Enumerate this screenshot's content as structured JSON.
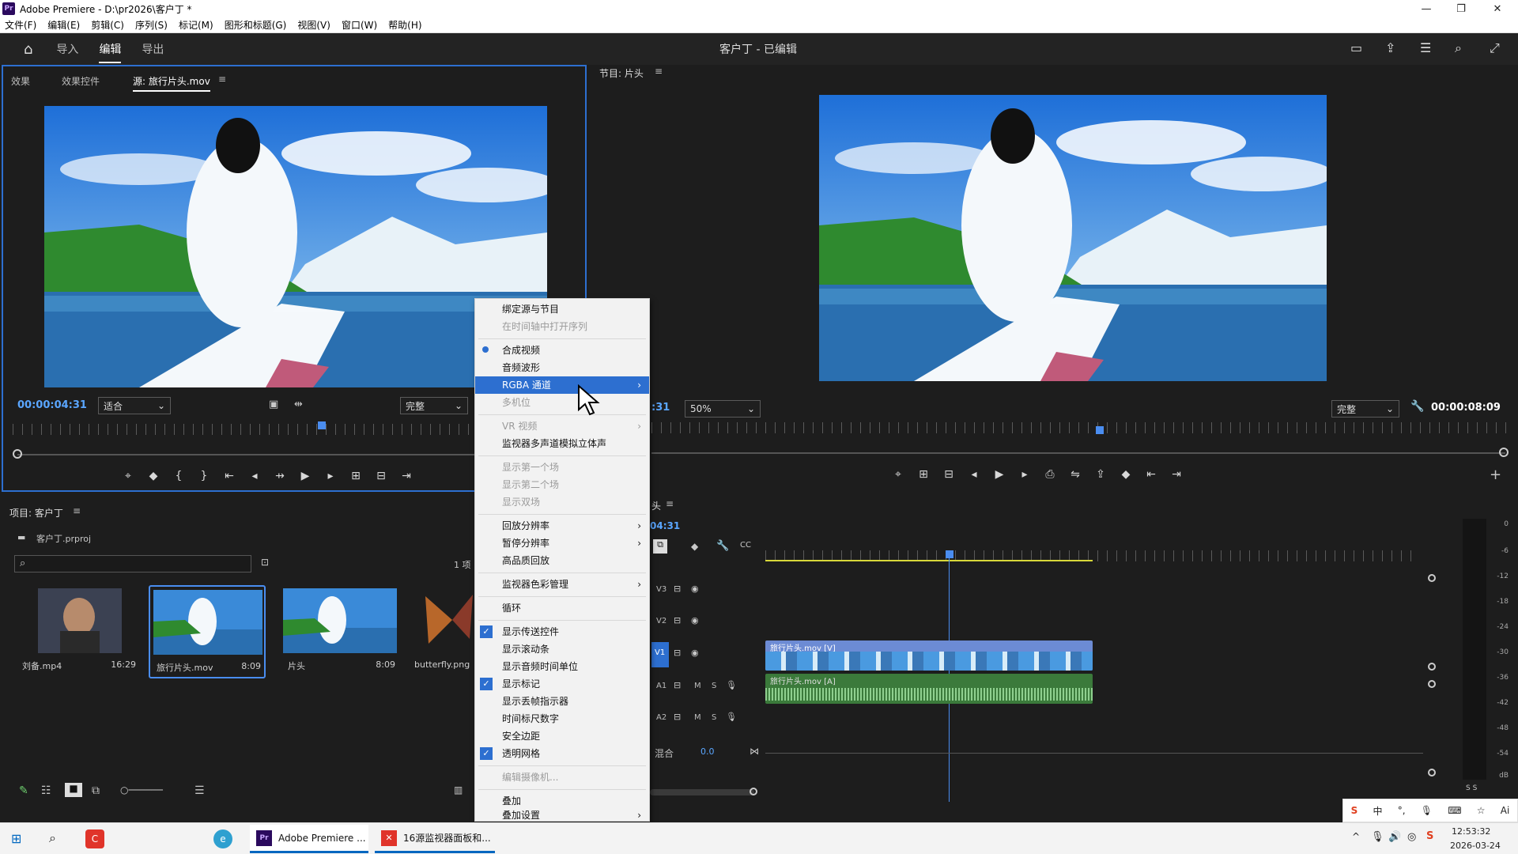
{
  "window": {
    "title": "Adobe Premiere - D:\\pr2026\\客户丁 *",
    "logo": "Pr",
    "controls": {
      "minimize": "—",
      "maximize": "❐",
      "close": "✕"
    }
  },
  "menu": [
    "文件(F)",
    "编辑(E)",
    "剪辑(C)",
    "序列(S)",
    "标记(M)",
    "图形和标题(G)",
    "视图(V)",
    "窗口(W)",
    "帮助(H)"
  ],
  "header": {
    "workspaces": [
      "导入",
      "编辑",
      "导出"
    ],
    "active_workspace": "编辑",
    "project_status": "客户丁 - 已编辑"
  },
  "source": {
    "tabs": [
      "效果",
      "效果控件",
      "源: 旅行片头.mov"
    ],
    "timecode": "00:00:04:31",
    "fit": "适合",
    "quality": "完整"
  },
  "program": {
    "title": "节目: 片头",
    "timecode_left": ":31",
    "zoom": "50%",
    "quality": "完整",
    "timecode_right": "00:00:08:09"
  },
  "context_menu": {
    "items": [
      {
        "label": "绑定源与节目",
        "state": "normal"
      },
      {
        "label": "在时间轴中打开序列",
        "state": "disabled"
      },
      {
        "label": "合成视频",
        "state": "radio"
      },
      {
        "label": "音频波形",
        "state": "normal"
      },
      {
        "label": "RGBA 通道",
        "state": "highlight",
        "submenu": true
      },
      {
        "label": "多机位",
        "state": "disabled"
      },
      {
        "label": "VR 视频",
        "state": "disabled",
        "submenu": true
      },
      {
        "label": "监视器多声道模拟立体声",
        "state": "normal"
      },
      {
        "label": "显示第一个场",
        "state": "disabled"
      },
      {
        "label": "显示第二个场",
        "state": "disabled"
      },
      {
        "label": "显示双场",
        "state": "disabled"
      },
      {
        "label": "回放分辨率",
        "state": "normal",
        "submenu": true
      },
      {
        "label": "暂停分辨率",
        "state": "normal",
        "submenu": true
      },
      {
        "label": "高品质回放",
        "state": "normal"
      },
      {
        "label": "监视器色彩管理",
        "state": "normal",
        "submenu": true
      },
      {
        "label": "循环",
        "state": "normal"
      },
      {
        "label": "显示传送控件",
        "state": "checked"
      },
      {
        "label": "显示滚动条",
        "state": "normal"
      },
      {
        "label": "显示音频时间单位",
        "state": "normal"
      },
      {
        "label": "显示标记",
        "state": "checked"
      },
      {
        "label": "显示丢帧指示器",
        "state": "normal"
      },
      {
        "label": "时间标尺数字",
        "state": "normal"
      },
      {
        "label": "安全边距",
        "state": "normal"
      },
      {
        "label": "透明网格",
        "state": "checked"
      },
      {
        "label": "编辑摄像机...",
        "state": "disabled"
      },
      {
        "label": "叠加",
        "state": "normal"
      },
      {
        "label": "叠加设置",
        "state": "normal",
        "submenu": true
      }
    ]
  },
  "project": {
    "title": "项目: 客户丁",
    "file": "客户丁.prproj",
    "count": "1 项",
    "search_placeholder": "",
    "items": [
      {
        "name": "刘备.mp4",
        "duration": "16:29"
      },
      {
        "name": "旅行片头.mov",
        "duration": "8:09"
      },
      {
        "name": "片头",
        "duration": "8:09"
      },
      {
        "name": "butterfly.png",
        "duration": ""
      }
    ]
  },
  "timeline": {
    "title": "头",
    "timecode": "04:31",
    "tracks": [
      "V3",
      "V2",
      "V1",
      "A1",
      "A2"
    ],
    "mix_label": "混合",
    "mix_value": "0.0",
    "clip_video": "旅行片头.mov [V]",
    "clip_audio": "旅行片头.mov [A]",
    "track_buttons": {
      "m": "M",
      "s": "S"
    }
  },
  "meter": {
    "labels": [
      "0",
      "-6",
      "-12",
      "-18",
      "-24",
      "-30",
      "-36",
      "-42",
      "-48",
      "-54",
      "dB"
    ],
    "solo": "S  S"
  },
  "taskbar": {
    "apps": [
      "Adobe Premiere ...",
      "16源监视器面板和..."
    ],
    "time": "12:53:32",
    "date": "2026-03-24",
    "ime": "中"
  }
}
